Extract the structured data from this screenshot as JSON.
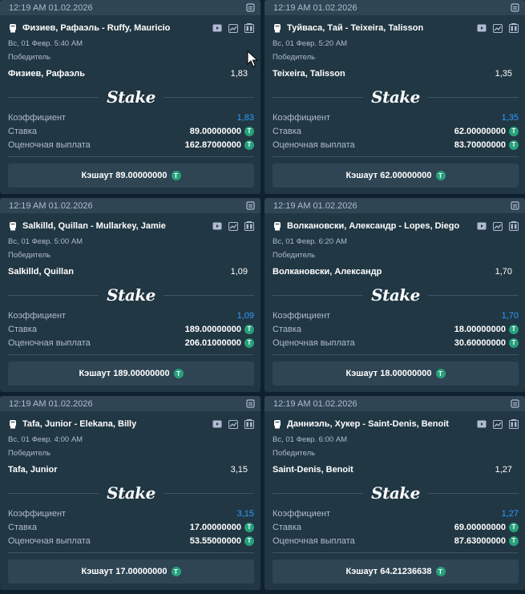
{
  "labels": {
    "market": "Победитель",
    "odds": "Коэффициент",
    "stake": "Ставка",
    "payout": "Оценочная выплата",
    "logo": "Stake",
    "token_symbol": "T"
  },
  "colors": {
    "odds_blue": "#2f9bff",
    "token_green": "#26a17b"
  },
  "cards": [
    {
      "timestamp": "12:19 AM 01.02.2026",
      "match": "Физиев, Рафаэль - Ruffy, Mauricio",
      "date": "Вс, 01 Февр.  5:40 AM",
      "pick": "Физиев, Рафаэль",
      "pick_odds": "1,83",
      "odds": "1,83",
      "stake": "89.00000000",
      "payout": "162.87000000",
      "cashout": "Кэшаут 89.00000000"
    },
    {
      "timestamp": "12:19 AM 01.02.2026",
      "match": "Туйваса, Тай - Teixeira, Talisson",
      "date": "Вс, 01 Февр.  5:20 AM",
      "pick": "Teixeira, Talisson",
      "pick_odds": "1,35",
      "odds": "1,35",
      "stake": "62.00000000",
      "payout": "83.70000000",
      "cashout": "Кэшаут 62.00000000"
    },
    {
      "timestamp": "12:19 AM 01.02.2026",
      "match": "Salkilld, Quillan - Mullarkey, Jamie",
      "date": "Вс, 01 Февр.  5:00 AM",
      "pick": "Salkilld, Quillan",
      "pick_odds": "1,09",
      "odds": "1,09",
      "stake": "189.00000000",
      "payout": "206.01000000",
      "cashout": "Кэшаут 189.00000000"
    },
    {
      "timestamp": "12:19 AM 01.02.2026",
      "match": "Волкановски, Александр - Lopes, Diego",
      "date": "Вс, 01 Февр.  6:20 AM",
      "pick": "Волкановски, Александр",
      "pick_odds": "1,70",
      "odds": "1,70",
      "stake": "18.00000000",
      "payout": "30.60000000",
      "cashout": "Кэшаут 18.00000000"
    },
    {
      "timestamp": "12:19 AM 01.02.2026",
      "match": "Tafa, Junior - Elekana, Billy",
      "date": "Вс, 01 Февр.  4:00 AM",
      "pick": "Tafa, Junior",
      "pick_odds": "3,15",
      "odds": "3,15",
      "stake": "17.00000000",
      "payout": "53.55000000",
      "cashout": "Кэшаут 17.00000000"
    },
    {
      "timestamp": "12:19 AM 01.02.2026",
      "match": "Данниэль, Хукер - Saint-Denis, Benoit",
      "date": "Вс, 01 Февр.  6:00 AM",
      "pick": "Saint-Denis, Benoit",
      "pick_odds": "1,27",
      "odds": "1,27",
      "stake": "69.00000000",
      "payout": "87.63000000",
      "cashout": "Кэшаут 64.21236638"
    }
  ]
}
